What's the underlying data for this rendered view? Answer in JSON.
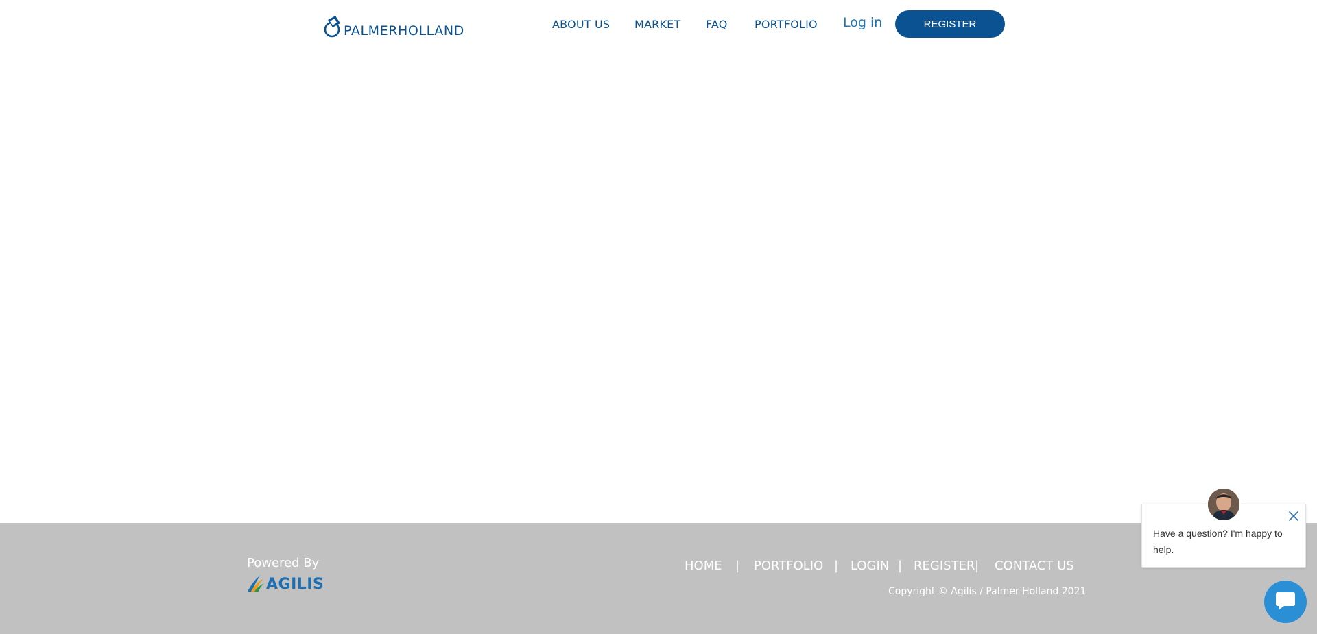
{
  "header": {
    "logo_text": "PALMERHOLLAND",
    "nav": {
      "about": "ABOUT US",
      "market": "MARKET",
      "faq": "FAQ",
      "portfolio": "PORTFOLIO"
    },
    "login": "Log in",
    "register": "REGISTER"
  },
  "footer": {
    "powered_by": "Powered By",
    "agilis_logo_text": "AGILIS",
    "links": {
      "home": "HOME",
      "portfolio": "PORTFOLIO",
      "login": "LOGIN",
      "register": "REGISTER",
      "contact": "CONTACT US"
    },
    "separator": "|",
    "copyright": "Copyright © Agilis / Palmer Holland 2021"
  },
  "chat": {
    "message": "Have a question? I'm happy to help.",
    "close_icon": "close-icon",
    "launcher_icon": "chat-bubble-icon"
  },
  "colors": {
    "brand_blue": "#0a5291",
    "link_blue": "#1b75bb",
    "footer_bg": "#c1c1c1",
    "chat_blue": "#2b8fd6"
  }
}
